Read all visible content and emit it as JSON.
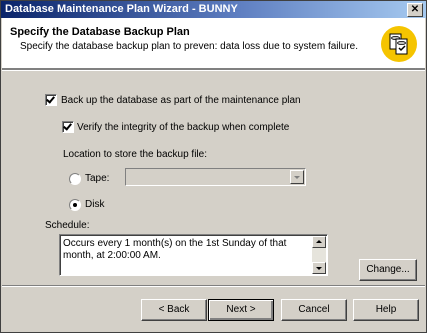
{
  "window": {
    "title": "Database Maintenance Plan Wizard - BUNNY",
    "close_glyph": "✕"
  },
  "header": {
    "title": "Specify the Database Backup Plan",
    "subtitle": "Specify the database backup plan to preven: data loss due to system failure."
  },
  "options": {
    "backup_label": "Back up the database as part of the maintenance plan",
    "backup_checked": true,
    "verify_label": "Verify the integrity of the backup when complete",
    "verify_checked": true,
    "location_label": "Location to store the backup file:",
    "tape_label": "Tape:",
    "tape_selected": false,
    "tape_value": "",
    "disk_label": "Disk",
    "disk_selected": true
  },
  "schedule": {
    "label": "Schedule:",
    "text": "Occurs every 1 month(s) on the 1st Sunday of that month, at 2:00:00 AM.",
    "change_button": "Change..."
  },
  "nav": {
    "back": "< Back",
    "next": "Next >",
    "cancel": "Cancel",
    "help": "Help"
  },
  "icons": {
    "wizard": "database-backup-icon"
  },
  "colors": {
    "title_gradient_start": "#0a246a",
    "title_gradient_end": "#a6caf0",
    "icon_circle": "#f5c400",
    "face": "#d4d0c8"
  }
}
